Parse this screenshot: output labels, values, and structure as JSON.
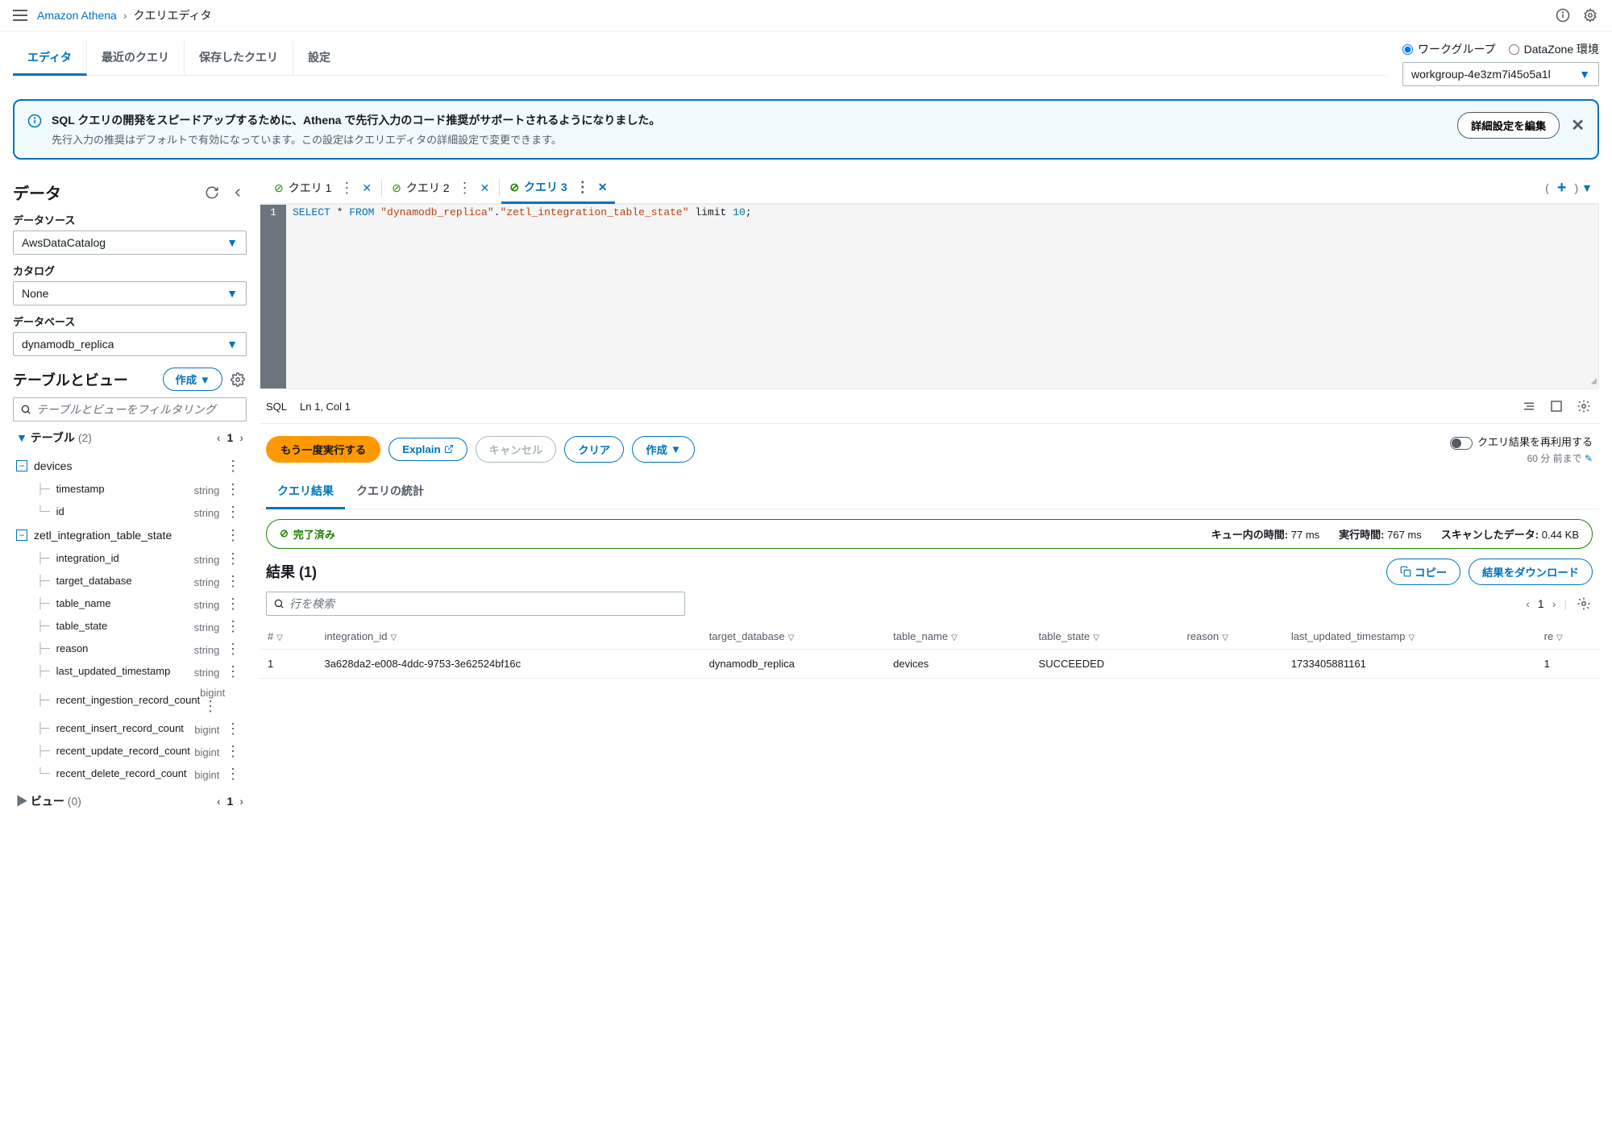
{
  "breadcrumb": {
    "service": "Amazon Athena",
    "page": "クエリエディタ"
  },
  "nav_tabs": [
    "エディタ",
    "最近のクエリ",
    "保存したクエリ",
    "設定"
  ],
  "workgroup": {
    "radio1": "ワークグループ",
    "radio2": "DataZone 環境",
    "selected": "workgroup-4e3zm7i45o5a1l"
  },
  "banner": {
    "title": "SQL クエリの開発をスピードアップするために、Athena で先行入力のコード推奨がサポートされるようになりました。",
    "subtitle": "先行入力の推奨はデフォルトで有効になっています。この設定はクエリエディタの詳細設定で変更できます。",
    "action": "詳細設定を編集"
  },
  "sidebar": {
    "title": "データ",
    "ds_label": "データソース",
    "ds_value": "AwsDataCatalog",
    "catalog_label": "カタログ",
    "catalog_value": "None",
    "db_label": "データベース",
    "db_value": "dynamodb_replica",
    "tables_views": "テーブルとビュー",
    "create_btn": "作成",
    "filter_placeholder": "テーブルとビューをフィルタリング",
    "tables_label": "テーブル",
    "tables_count": "(2)",
    "page": "1",
    "table1": {
      "name": "devices",
      "cols": [
        {
          "name": "timestamp",
          "type": "string"
        },
        {
          "name": "id",
          "type": "string"
        }
      ]
    },
    "table2": {
      "name": "zetl_integration_table_state",
      "cols": [
        {
          "name": "integration_id",
          "type": "string"
        },
        {
          "name": "target_database",
          "type": "string"
        },
        {
          "name": "table_name",
          "type": "string"
        },
        {
          "name": "table_state",
          "type": "string"
        },
        {
          "name": "reason",
          "type": "string"
        },
        {
          "name": "last_updated_timestamp",
          "type": "string"
        },
        {
          "name": "recent_ingestion_record_count",
          "type": "bigint"
        },
        {
          "name": "recent_insert_record_count",
          "type": "bigint"
        },
        {
          "name": "recent_update_record_count",
          "type": "bigint"
        },
        {
          "name": "recent_delete_record_count",
          "type": "bigint"
        }
      ]
    },
    "views_label": "ビュー",
    "views_count": "(0)",
    "views_page": "1"
  },
  "editor": {
    "tabs": [
      "クエリ 1",
      "クエリ 2",
      "クエリ 3"
    ],
    "active": 2,
    "code_line": "1",
    "sql_select": "SELECT",
    "sql_mid": " * ",
    "sql_from": "FROM",
    "sql_str1": " \"dynamodb_replica\"",
    "sql_dot": ".",
    "sql_str2": "\"zetl_integration_table_state\"",
    "sql_limit": " limit ",
    "sql_num": "10",
    "sql_semi": ";",
    "status_lang": "SQL",
    "status_pos": "Ln 1, Col 1"
  },
  "actions": {
    "run": "もう一度実行する",
    "explain": "Explain",
    "cancel": "キャンセル",
    "clear": "クリア",
    "create": "作成",
    "reuse": "クエリ結果を再利用する",
    "reuse_sub": "60 分 前まで"
  },
  "result_tabs": [
    "クエリ結果",
    "クエリの統計"
  ],
  "success": {
    "status": "完了済み",
    "queue_label": "キュー内の時間:",
    "queue_val": "77 ms",
    "run_label": "実行時間:",
    "run_val": "767 ms",
    "scan_label": "スキャンしたデータ:",
    "scan_val": "0.44 KB"
  },
  "results": {
    "title": "結果 (1)",
    "copy": "コピー",
    "download": "結果をダウンロード",
    "filter_placeholder": "行を検索",
    "page": "1",
    "headers": [
      "#",
      "integration_id",
      "target_database",
      "table_name",
      "table_state",
      "reason",
      "last_updated_timestamp",
      "re"
    ],
    "row": [
      "1",
      "3a628da2-e008-4ddc-9753-3e62524bf16c",
      "dynamodb_replica",
      "devices",
      "SUCCEEDED",
      "",
      "1733405881161",
      "1"
    ]
  }
}
